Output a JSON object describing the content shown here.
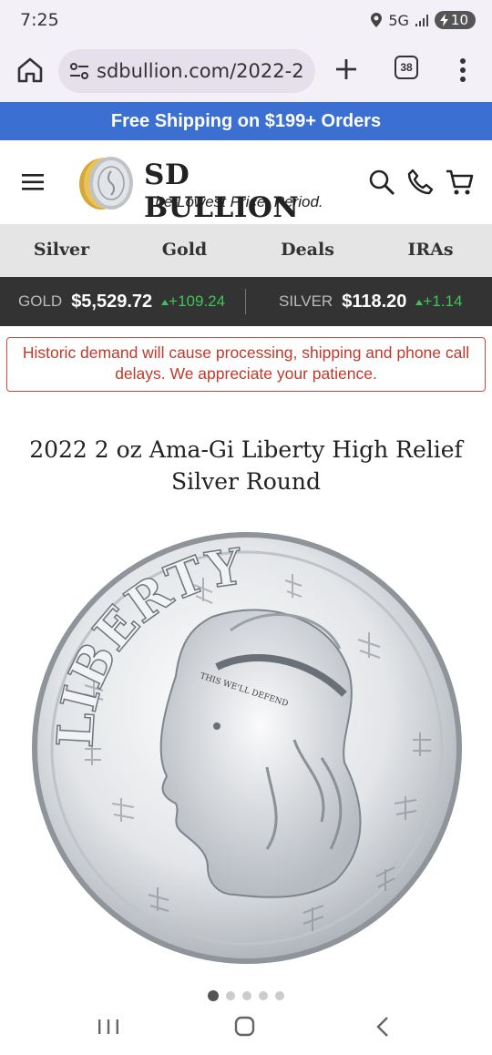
{
  "status_bar": {
    "time": "7:25",
    "network": "5G",
    "battery": "10"
  },
  "browser": {
    "url": "sdbullion.com/2022-2",
    "tab_count": "38"
  },
  "promo": {
    "text": "Free Shipping on $199+ Orders",
    "bg_color": "#3b6fd1"
  },
  "header": {
    "brand": "SD BULLION",
    "tagline": "The Lowest Price. Period."
  },
  "nav": {
    "items": [
      "Silver",
      "Gold",
      "Deals",
      "IRAs"
    ]
  },
  "ticker": {
    "gold": {
      "label": "GOLD",
      "price": "$5,529.72",
      "change": "+109.24"
    },
    "silver": {
      "label": "SILVER",
      "price": "$118.20",
      "change": "+1.14"
    }
  },
  "notice": {
    "text": "Historic demand will cause processing, shipping and phone call delays. We appreciate your patience."
  },
  "product": {
    "title": "2022 2 oz Ama-Gi Liberty High Relief Silver Round",
    "coin_legend": "LIBERTY",
    "headband": "THIS WE'LL DEFEND",
    "slides": 5,
    "active_slide": 1
  },
  "icons": {
    "home": "home-icon",
    "tune": "tune-icon",
    "new_tab": "plus-icon",
    "tabs": "tab-switcher-icon",
    "overflow": "more-vert-icon",
    "menu": "hamburger-icon",
    "search": "search-icon",
    "phone": "phone-icon",
    "cart": "cart-icon",
    "recents": "recents-icon",
    "home_nav": "home-nav-icon",
    "back": "back-icon"
  }
}
